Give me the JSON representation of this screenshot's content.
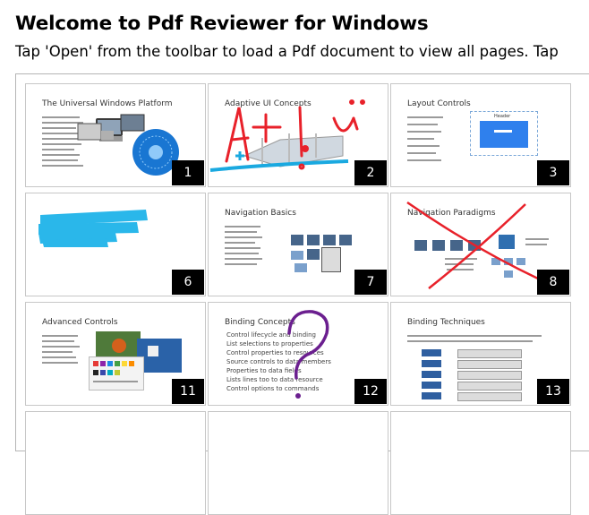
{
  "header": {
    "title": "Welcome to Pdf Reviewer for Windows",
    "subtitle": "Tap 'Open' from the toolbar to load a Pdf document to view all pages. Tap"
  },
  "thumbnails": [
    {
      "title": "The Universal Windows Platform",
      "page": "1"
    },
    {
      "title": "Adaptive UI Concepts",
      "page": "2"
    },
    {
      "title": "Layout Controls",
      "page": "3"
    },
    {
      "title": "",
      "page": "6"
    },
    {
      "title": "Navigation Basics",
      "page": "7"
    },
    {
      "title": "Navigation Paradigms",
      "page": "8"
    },
    {
      "title": "Advanced Controls",
      "page": "11"
    },
    {
      "title": "Binding Concepts",
      "page": "12"
    },
    {
      "title": "Binding Techniques",
      "page": "13"
    }
  ],
  "slide3": {
    "window_label": "Header"
  },
  "slide12": {
    "bullets": [
      "Control lifecycle and binding",
      "List selections to properties",
      "Control properties to resources",
      "Source controls to data members",
      "Properties to data fields",
      "Lists lines too to data resource",
      "Control options to commands"
    ]
  },
  "annotation_colors": {
    "red_ink": "#e8212a",
    "blue_highlighter": "#2ab7ea",
    "purple_ink": "#6b1f8f",
    "cyan_stroke": "#1aa9e0"
  }
}
